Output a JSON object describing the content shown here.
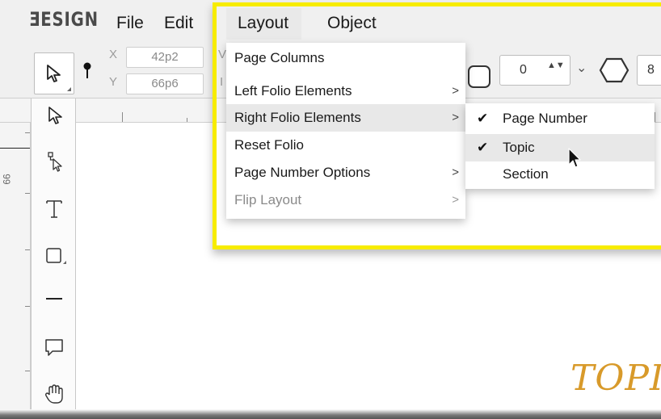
{
  "app": {
    "logo": "ƎESIGN"
  },
  "menubar": {
    "items": [
      "File",
      "Edit",
      "Layout",
      "Object"
    ]
  },
  "controlbar": {
    "x_label": "X",
    "x_value": "42p2",
    "y_label": "Y",
    "y_value": "66p6",
    "w_label_partial": "V",
    "h_label_partial": "I",
    "corner_value": "0",
    "spin_arrows": "▲▼",
    "chevron": "⌄",
    "stroke_value_partial": "8"
  },
  "ruler": {
    "vertical_number": "66"
  },
  "layout_menu": {
    "items": [
      {
        "label": "Page Columns",
        "submenu": false,
        "arrow": ""
      },
      {
        "label": "Left Folio Elements",
        "submenu": true,
        "arrow": ">"
      },
      {
        "label": "Right Folio Elements",
        "submenu": true,
        "arrow": ">",
        "active": true
      },
      {
        "label": "Reset Folio",
        "submenu": false,
        "arrow": ""
      },
      {
        "label": "Page Number Options",
        "submenu": true,
        "arrow": ">"
      },
      {
        "label": "Flip Layout",
        "submenu": true,
        "arrow": ">",
        "disabled": true
      }
    ]
  },
  "right_folio_submenu": {
    "items": [
      {
        "label": "Page Number",
        "checked": true,
        "check": "✔"
      },
      {
        "label": "Topic",
        "checked": true,
        "check": "✔",
        "hover": true
      },
      {
        "label": "Section",
        "checked": false,
        "check": ""
      }
    ]
  },
  "canvas": {
    "topic_text_partial": "TOPI"
  },
  "colors": {
    "highlight": "#f7ec00",
    "topic_text": "#d89a2a",
    "menu_hover": "#e8e8e8"
  }
}
